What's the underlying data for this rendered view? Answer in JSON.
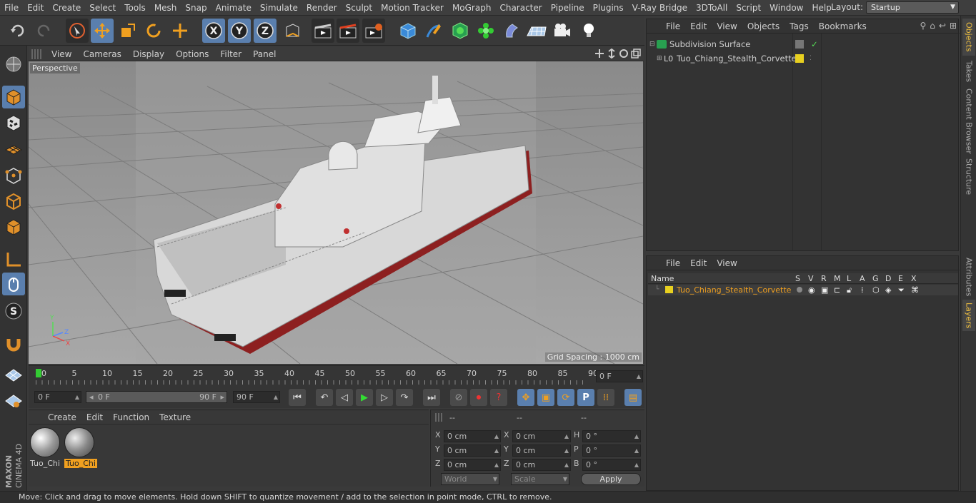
{
  "menu": [
    "File",
    "Edit",
    "Create",
    "Select",
    "Tools",
    "Mesh",
    "Snap",
    "Animate",
    "Simulate",
    "Render",
    "Sculpt",
    "Motion Tracker",
    "MoGraph",
    "Character",
    "Pipeline",
    "Plugins",
    "V-Ray Bridge",
    "3DToAll",
    "Script",
    "Window",
    "Help"
  ],
  "layout": {
    "label": "Layout:",
    "value": "Startup"
  },
  "viewport": {
    "menu": [
      "View",
      "Cameras",
      "Display",
      "Options",
      "Filter",
      "Panel"
    ],
    "label": "Perspective",
    "grid_spacing": "Grid Spacing : 1000 cm"
  },
  "timeline": {
    "ticks": [
      "0",
      "5",
      "10",
      "15",
      "20",
      "25",
      "30",
      "35",
      "40",
      "45",
      "50",
      "55",
      "60",
      "65",
      "70",
      "75",
      "80",
      "85",
      "90"
    ],
    "current_frame": "0 F"
  },
  "transport": {
    "start": "0 F",
    "range_start": "0 F",
    "range_end": "90 F",
    "end": "90 F"
  },
  "materials": {
    "menu": [
      "Create",
      "Edit",
      "Function",
      "Texture"
    ],
    "items": [
      {
        "label": "Tuo_Chi",
        "selected": false
      },
      {
        "label": "Tuo_Chi",
        "selected": true
      }
    ]
  },
  "coords": {
    "headers": [
      "--",
      "--",
      "--"
    ],
    "rows": [
      {
        "a": "X",
        "av": "0 cm",
        "b": "X",
        "bv": "0 cm",
        "c": "H",
        "cv": "0 °"
      },
      {
        "a": "Y",
        "av": "0 cm",
        "b": "Y",
        "bv": "0 cm",
        "c": "P",
        "cv": "0 °"
      },
      {
        "a": "Z",
        "av": "0 cm",
        "b": "Z",
        "bv": "0 cm",
        "c": "B",
        "cv": "0 °"
      }
    ],
    "mode1": "World",
    "mode2": "Scale",
    "apply": "Apply"
  },
  "objects": {
    "menu": [
      "File",
      "Edit",
      "View",
      "Objects",
      "Tags",
      "Bookmarks"
    ],
    "tree": [
      {
        "label": "Subdivision Surface",
        "icon": "subdivision-icon"
      },
      {
        "label": "Tuo_Chiang_Stealth_Corvette",
        "icon": "null-object-icon"
      }
    ]
  },
  "layers": {
    "menu": [
      "File",
      "Edit",
      "View"
    ],
    "columns": [
      "Name",
      "S",
      "V",
      "R",
      "M",
      "L",
      "A",
      "G",
      "D",
      "E",
      "X"
    ],
    "rows": [
      {
        "label": "Tuo_Chiang_Stealth_Corvette",
        "color": "#e8d020"
      }
    ]
  },
  "right_tabs": [
    "Objects",
    "Takes",
    "Content Browser",
    "Structure",
    "Attributes",
    "Layers"
  ],
  "brand": {
    "line1": "MAXON",
    "line2": "CINEMA 4D"
  },
  "status": "Move: Click and drag to move elements. Hold down SHIFT to quantize movement / add to the selection in point mode, CTRL to remove.",
  "colors": {
    "accent": "#5a7fae",
    "layer_yellow": "#e8d020",
    "selected_text": "#f0a020"
  }
}
